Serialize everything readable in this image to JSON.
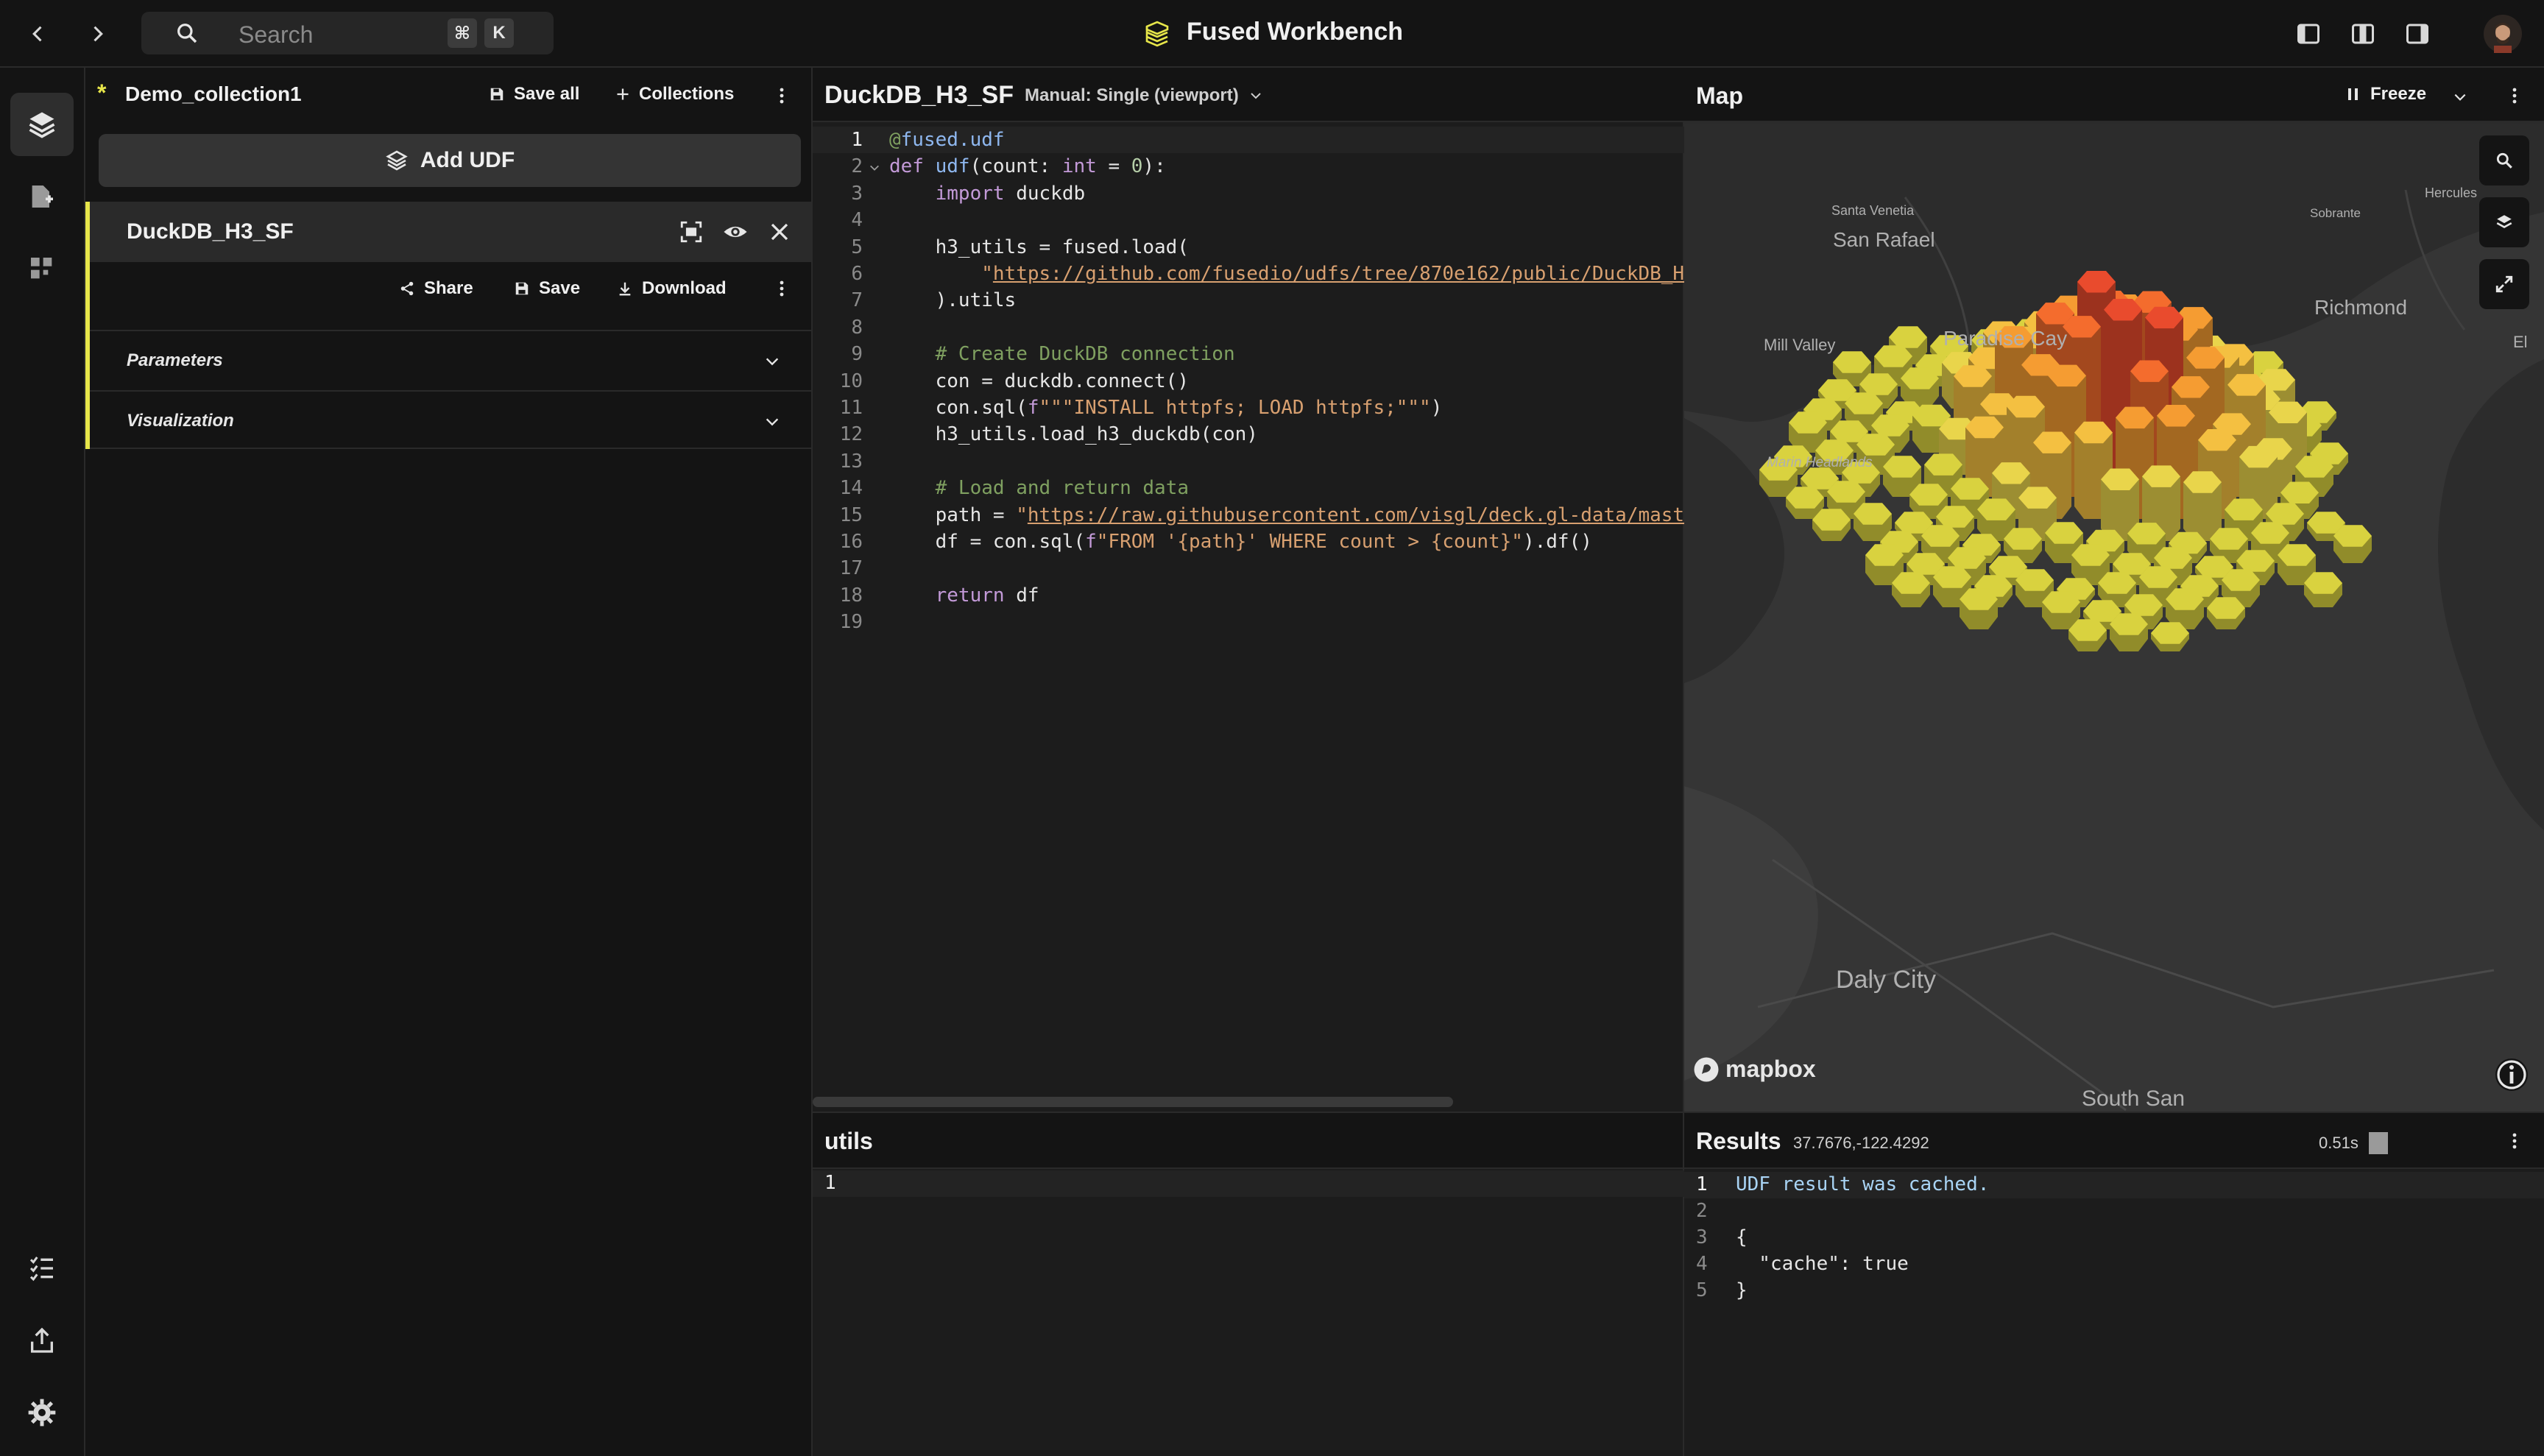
{
  "app": {
    "title": "Fused Workbench"
  },
  "search": {
    "placeholder": "Search",
    "shortcut_mod": "⌘",
    "shortcut_key": "K"
  },
  "collection": {
    "name": "Demo_collection1",
    "modified_marker": "*",
    "save_all_label": "Save all",
    "collections_label": "Collections",
    "add_udf_label": "Add UDF"
  },
  "udf": {
    "name": "DuckDB_H3_SF",
    "share_label": "Share",
    "save_label": "Save",
    "download_label": "Download",
    "sections": [
      "Parameters",
      "Visualization"
    ]
  },
  "editor": {
    "title": "DuckDB_H3_SF",
    "mode": "Manual: Single (viewport)",
    "line_numbers": [
      "1",
      "2",
      "3",
      "4",
      "5",
      "6",
      "7",
      "8",
      "9",
      "10",
      "11",
      "12",
      "13",
      "14",
      "15",
      "16",
      "17",
      "18",
      "19"
    ]
  },
  "map": {
    "title": "Map",
    "freeze_label": "Freeze",
    "places": {
      "santa_venetia": "Santa Venetia",
      "san_rafael": "San Rafael",
      "sobrante": "Sobrante",
      "hercules": "Hercules",
      "richmond": "Richmond",
      "el": "El",
      "mill_valley": "Mill Valley",
      "paradise_cay": "Paradise Cay",
      "marin_headlands": "Marin Headlands",
      "daly_city": "Daly City",
      "south_san": "South San"
    },
    "attribution": "mapbox"
  },
  "utils": {
    "title": "utils",
    "line_numbers": [
      "1"
    ]
  },
  "results": {
    "title": "Results",
    "coords": "37.7676,-122.4292",
    "timing": "0.51s",
    "line_numbers": [
      "1",
      "2",
      "3",
      "4",
      "5"
    ],
    "lines": [
      "UDF result was cached.",
      "",
      "{",
      "  \"cache\": true",
      "}"
    ]
  }
}
